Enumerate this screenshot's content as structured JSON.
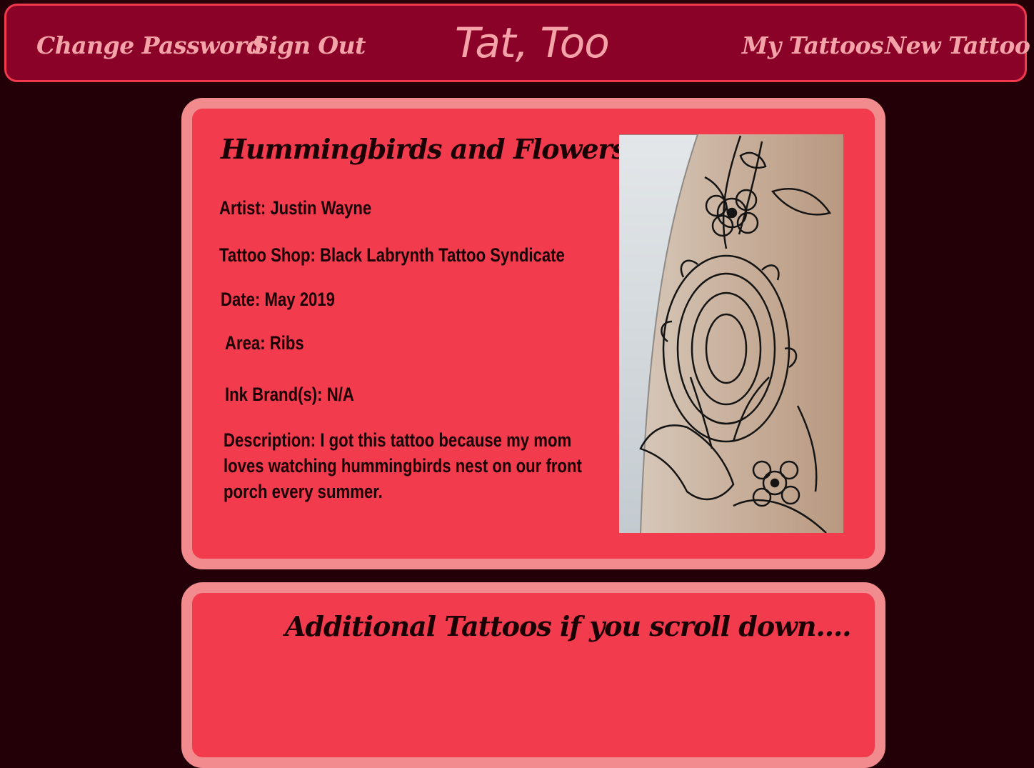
{
  "nav": {
    "change_password": "Change Password",
    "sign_out": "Sign Out",
    "brand": "Tat, Too",
    "my_tattoos": "My Tattoos",
    "new_tattoo": "New Tattoo"
  },
  "tattoo": {
    "title": "Hummingbirds and Flowers",
    "artist_label": "Artist:",
    "artist": "Justin Wayne",
    "shop_label": "Tattoo Shop:",
    "shop": "Black Labrynth Tattoo Syndicate",
    "date_label": "Date:",
    "date": "May 2019",
    "area_label": "Area:",
    "area": "Ribs",
    "ink_label": "Ink Brand(s):",
    "ink": "N/A",
    "description_label": "Description:",
    "description": "I got this tattoo because my mom loves watching hummingbirds nest on our front porch every summer."
  },
  "extra": {
    "title": "Additional Tattoos if you scroll down...."
  },
  "colors": {
    "background": "#230007",
    "navbar": "#8a0228",
    "nav_text": "#f4a3a9",
    "card": "#f23b4c",
    "card_border": "#f28b8d"
  }
}
